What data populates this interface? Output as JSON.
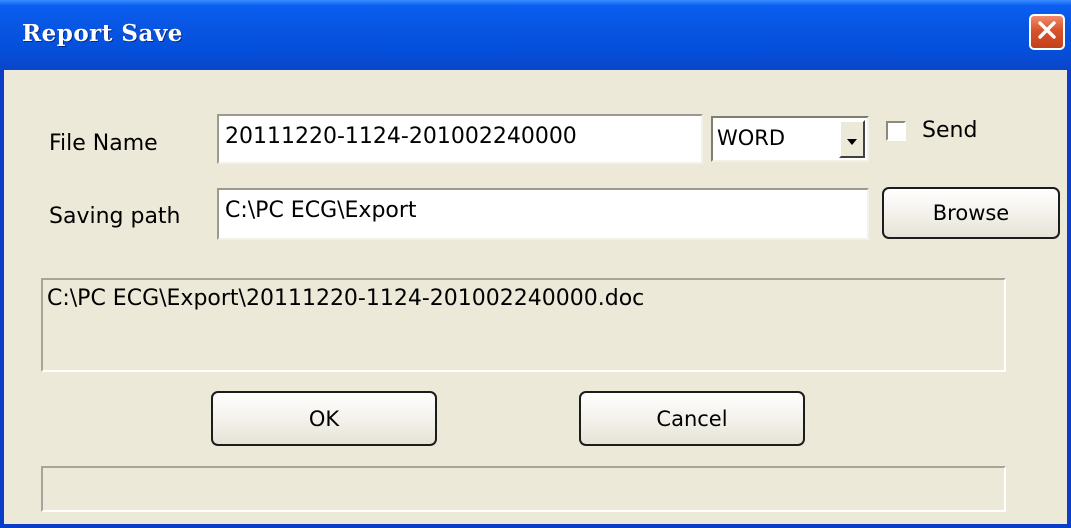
{
  "window": {
    "title": "Report Save"
  },
  "form": {
    "file_name_label": "File Name",
    "file_name_value": "20111220-1124-201002240000",
    "format_value": "WORD",
    "send_label": "Send",
    "send_checked": false,
    "saving_path_label": "Saving path",
    "saving_path_value": "C:\\PC ECG\\Export",
    "browse_label": "Browse"
  },
  "preview": {
    "full_path": "C:\\PC ECG\\Export\\20111220-1124-201002240000.doc"
  },
  "actions": {
    "ok_label": "OK",
    "cancel_label": "Cancel"
  },
  "status": {
    "text": ""
  },
  "icons": {
    "close": "close-icon",
    "dropdown": "chevron-down-icon"
  },
  "colors": {
    "titlebar": "#0855e2",
    "close_button": "#d8532a",
    "background": "#ece9d8"
  }
}
